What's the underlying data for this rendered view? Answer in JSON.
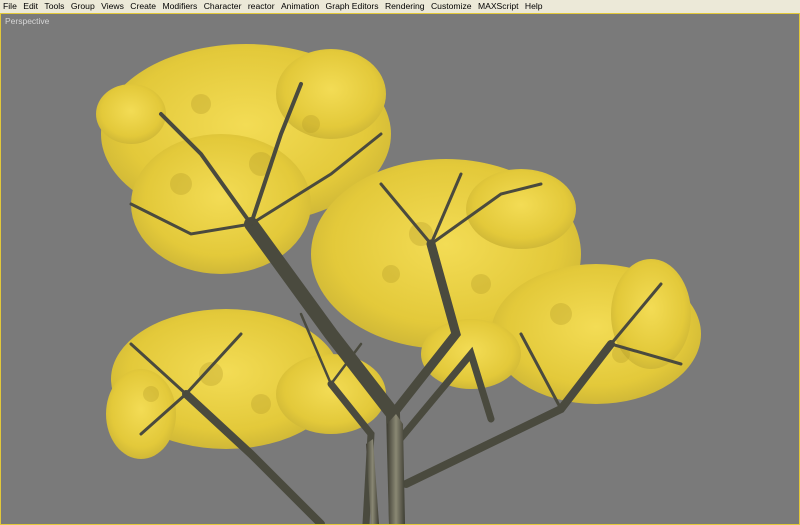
{
  "menubar": {
    "items": [
      "File",
      "Edit",
      "Tools",
      "Group",
      "Views",
      "Create",
      "Modifiers",
      "Character",
      "reactor",
      "Animation",
      "Graph Editors",
      "Rendering",
      "Customize",
      "MAXScript",
      "Help"
    ]
  },
  "viewport": {
    "label": "Perspective",
    "background_color": "#7a7a7a",
    "border_color": "#e2c83a",
    "object": "tree-model",
    "foliage_color": "#e8cf3a",
    "bark_color": "#5b5a4a"
  }
}
